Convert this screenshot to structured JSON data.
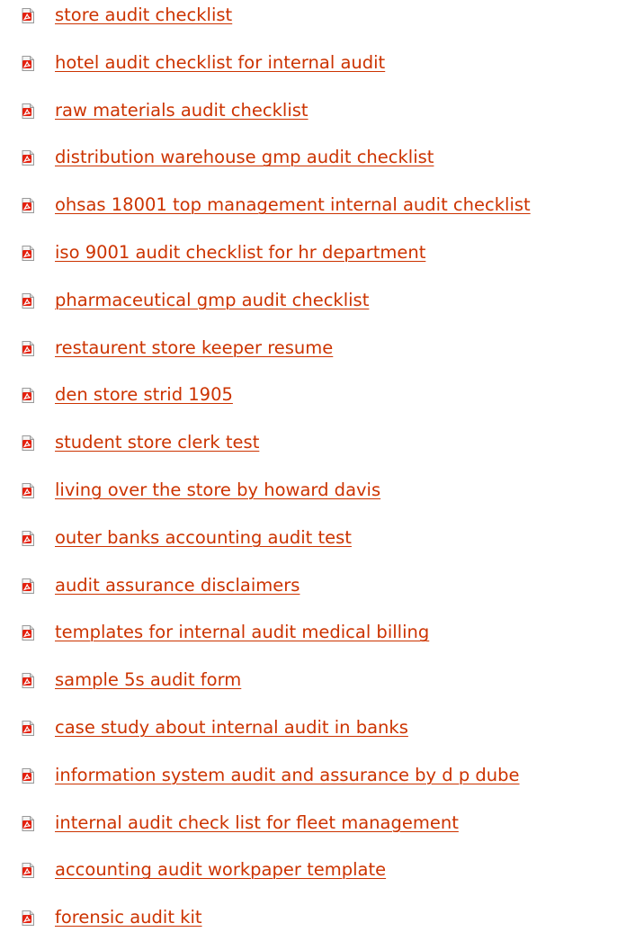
{
  "colors": {
    "link": "#cc3300",
    "icon_red": "#e4200e",
    "icon_page": "#d7d7d7"
  },
  "icon": "pdf-file-icon",
  "links": [
    {
      "label": "store audit checklist"
    },
    {
      "label": "hotel audit checklist for internal audit"
    },
    {
      "label": "raw materials audit checklist"
    },
    {
      "label": "distribution warehouse gmp audit checklist"
    },
    {
      "label": "ohsas 18001 top management internal audit checklist"
    },
    {
      "label": "iso 9001 audit checklist for hr department"
    },
    {
      "label": "pharmaceutical gmp audit checklist"
    },
    {
      "label": "restaurent store keeper resume"
    },
    {
      "label": "den store strid 1905"
    },
    {
      "label": "student store clerk test"
    },
    {
      "label": "living over the store by howard davis"
    },
    {
      "label": "outer banks accounting audit test"
    },
    {
      "label": "audit assurance disclaimers"
    },
    {
      "label": "templates for internal audit medical billing"
    },
    {
      "label": "sample 5s audit form"
    },
    {
      "label": "case study about internal audit in banks"
    },
    {
      "label": "information system audit and assurance by d p dube"
    },
    {
      "label": "internal audit check list for fleet management"
    },
    {
      "label": "accounting audit workpaper template"
    },
    {
      "label": "forensic audit kit"
    }
  ]
}
